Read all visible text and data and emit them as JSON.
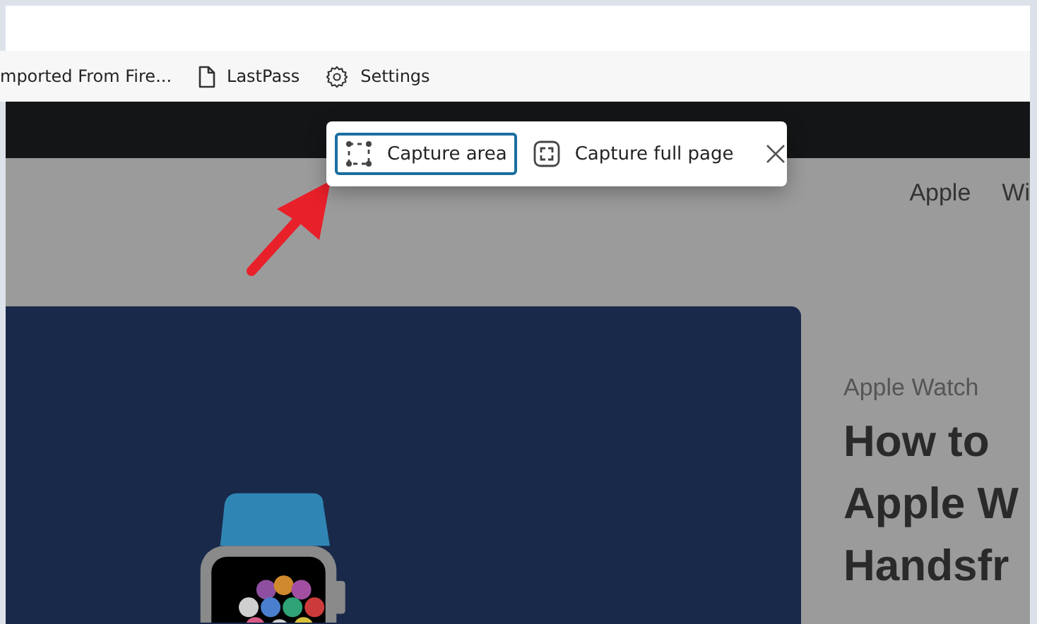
{
  "bookmarks": [
    {
      "label": "mported From Fire...",
      "kind": "plain"
    },
    {
      "label": "LastPass",
      "kind": "page"
    },
    {
      "label": "Settings",
      "kind": "gear"
    }
  ],
  "capture_toolbar": {
    "options": [
      {
        "label": "Capture area",
        "kind": "area",
        "selected": true
      },
      {
        "label": "Capture full page",
        "kind": "full",
        "selected": false
      }
    ]
  },
  "page": {
    "nav": [
      "Apple",
      "Wi"
    ],
    "article": {
      "category": "Apple Watch",
      "title_lines": [
        "How to",
        "Apple W",
        "Handsfr"
      ]
    }
  }
}
